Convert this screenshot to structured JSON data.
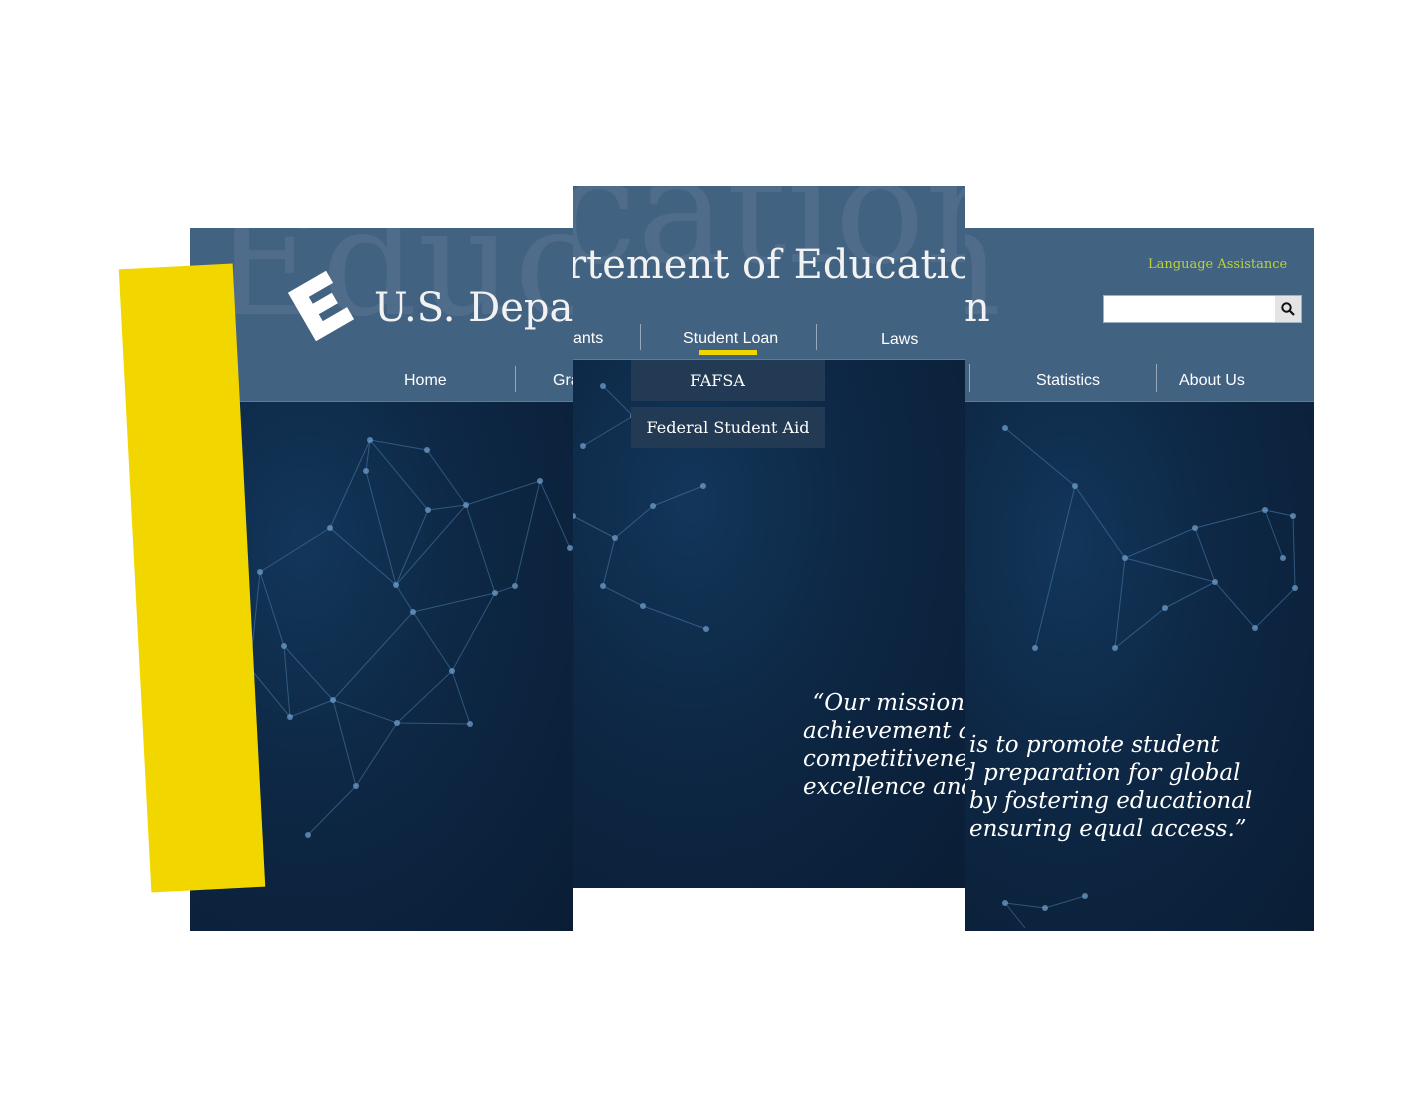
{
  "site": {
    "title": "U.S. Department of Education",
    "title_fragment_left": "U.S. Depar",
    "title_fragment_center": "rtement of Educatio",
    "title_fragment_right": "n",
    "watermark": "Education",
    "language_link": "Language Assistance",
    "search": {
      "value": "",
      "placeholder": ""
    }
  },
  "nav": {
    "home": "Home",
    "grants_left": "Gra",
    "grants_center": "ants",
    "student_loan": "Student Loan",
    "laws": "Laws",
    "statistics": "Statistics",
    "about": "About Us"
  },
  "dropdown": [
    "FAFSA",
    "Federal Student Aid"
  ],
  "quote": {
    "center_lines": [
      "“Our mission",
      "achievement an",
      "competitiveness",
      "excellence and"
    ],
    "right_lines": [
      "is to promote student",
      "d preparation for global",
      "by fostering educational",
      "ensuring equal access.”"
    ]
  },
  "colors": {
    "header": "#426282",
    "hero": "#0d2744",
    "accent_yellow": "#f2d600",
    "language_link": "#b9d33a",
    "dropdown_item": "#233a54"
  },
  "icons": {
    "search": "magnifier-icon",
    "logo": "education-logo-icon"
  }
}
